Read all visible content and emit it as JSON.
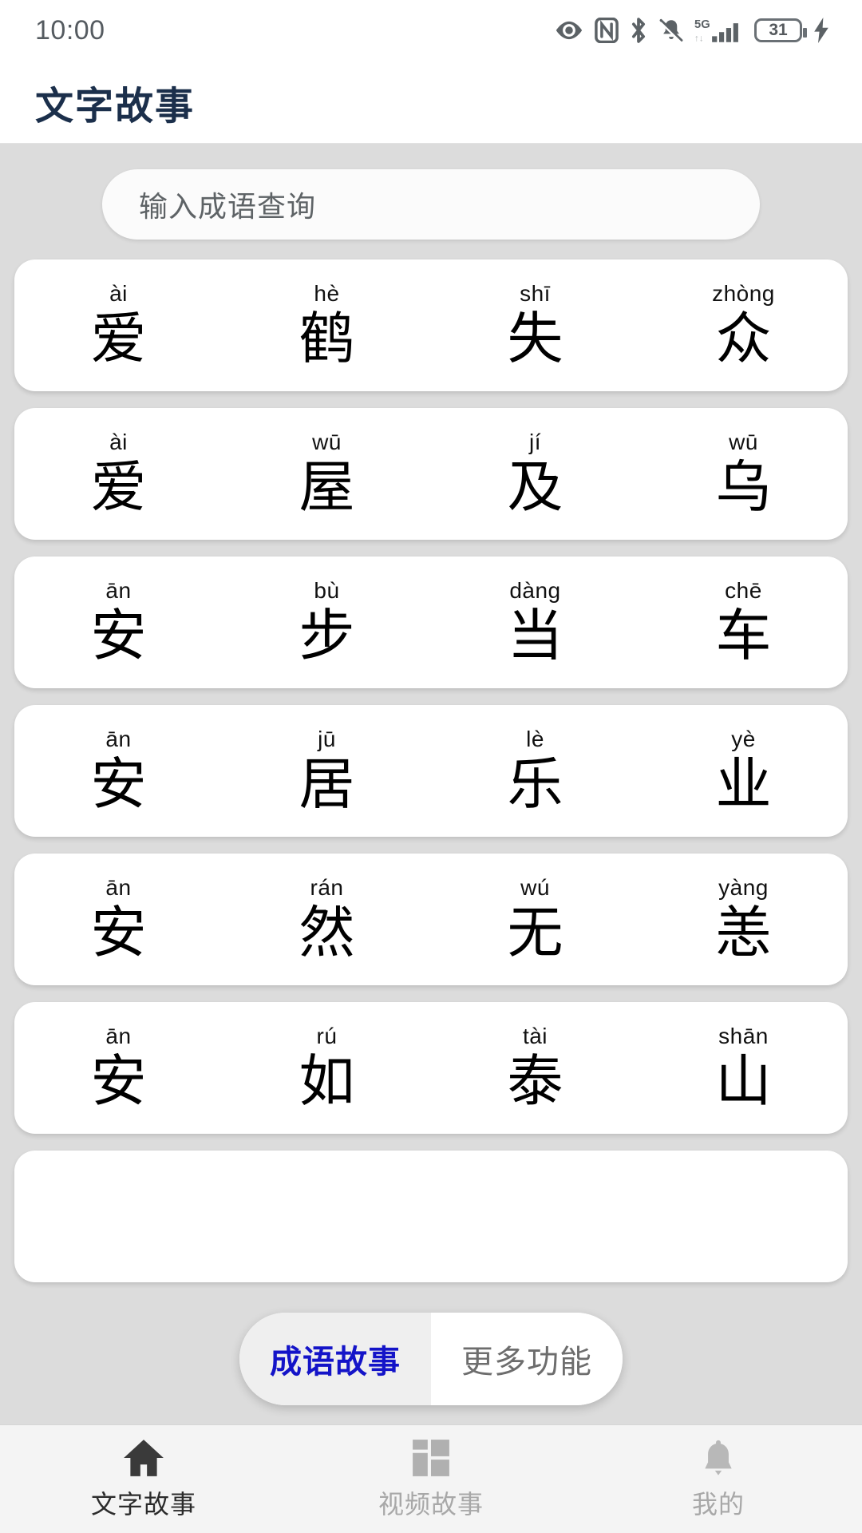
{
  "status_bar": {
    "time": "10:00",
    "battery_level": "31",
    "icons": [
      "eye-icon",
      "nfc-icon",
      "bluetooth-icon",
      "mute-bell-icon",
      "signal-5g-icon",
      "battery-icon",
      "charging-bolt-icon"
    ],
    "network": "5G"
  },
  "header": {
    "title": "文字故事"
  },
  "search": {
    "placeholder": "输入成语查询",
    "value": ""
  },
  "idioms": [
    {
      "pinyin": [
        "ài",
        "hè",
        "shī",
        "zhòng"
      ],
      "chars": [
        "爱",
        "鹤",
        "失",
        "众"
      ]
    },
    {
      "pinyin": [
        "ài",
        "wū",
        "jí",
        "wū"
      ],
      "chars": [
        "爱",
        "屋",
        "及",
        "乌"
      ]
    },
    {
      "pinyin": [
        "ān",
        "bù",
        "dàng",
        "chē"
      ],
      "chars": [
        "安",
        "步",
        "当",
        "车"
      ]
    },
    {
      "pinyin": [
        "ān",
        "jū",
        "lè",
        "yè"
      ],
      "chars": [
        "安",
        "居",
        "乐",
        "业"
      ]
    },
    {
      "pinyin": [
        "ān",
        "rán",
        "wú",
        "yàng"
      ],
      "chars": [
        "安",
        "然",
        "无",
        "恙"
      ]
    },
    {
      "pinyin": [
        "ān",
        "rú",
        "tài",
        "shān"
      ],
      "chars": [
        "安",
        "如",
        "泰",
        "山"
      ]
    }
  ],
  "segment": {
    "options": [
      {
        "label": "成语故事",
        "selected": true
      },
      {
        "label": "更多功能",
        "selected": false
      }
    ],
    "active_color": "#1414c8",
    "inactive_color": "#6d6d6d"
  },
  "bottom_nav": {
    "items": [
      {
        "label": "文字故事",
        "icon": "home-icon",
        "active": true
      },
      {
        "label": "视频故事",
        "icon": "grid-icon",
        "active": false
      },
      {
        "label": "我的",
        "icon": "bell-icon",
        "active": false
      }
    ]
  },
  "colors": {
    "page_background": "#dcdcdc",
    "card_background": "#ffffff",
    "title": "#1b2f4b",
    "accent": "#1414c8"
  }
}
